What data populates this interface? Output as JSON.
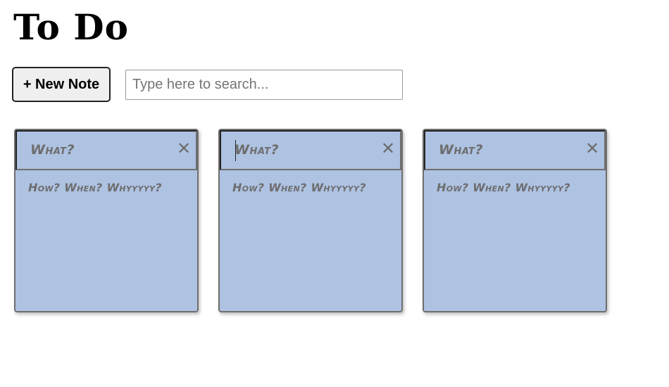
{
  "page": {
    "title": "To Do"
  },
  "toolbar": {
    "new_note_label": "+ New Note",
    "search_placeholder": "Type here to search...",
    "search_value": ""
  },
  "notes": [
    {
      "title_placeholder": "What?",
      "body_placeholder": "How? When? Whyyyyy?",
      "delete_icon": "✕"
    },
    {
      "title_placeholder": "What?",
      "body_placeholder": "How? When? Whyyyyy?",
      "delete_icon": "✕"
    },
    {
      "title_placeholder": "What?",
      "body_placeholder": "How? When? Whyyyyy?",
      "delete_icon": "✕"
    }
  ],
  "colors": {
    "note_background": "#aec2e2",
    "placeholder_text": "#6d6d6d"
  }
}
